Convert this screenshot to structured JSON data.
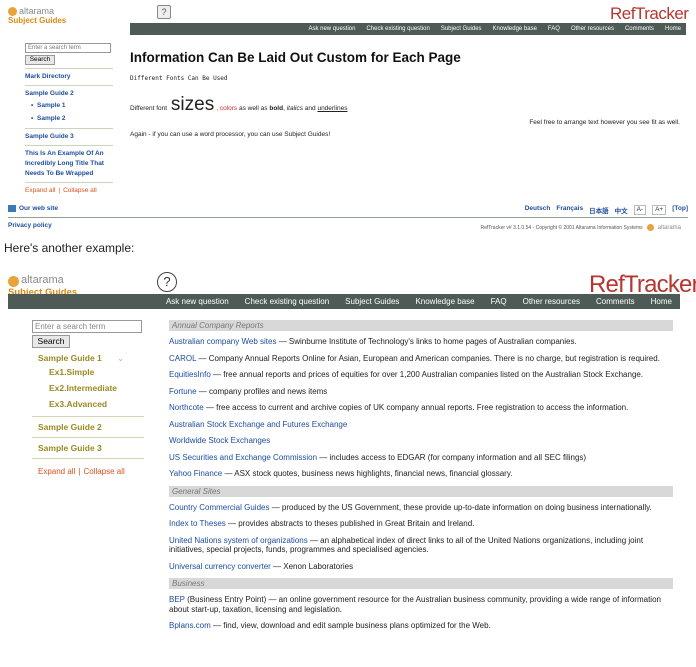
{
  "shot1": {
    "logo_brand": "altarama",
    "logo_subtitle": "Subject Guides",
    "help_icon": "help-icon",
    "reftracker": "RefTracker",
    "nav": [
      "Ask new question",
      "Check existing question",
      "Subject Guides",
      "Knowledge base",
      "FAQ",
      "Other resources",
      "Comments",
      "Home"
    ],
    "search_placeholder": "Enter a search term",
    "search_button": "Search",
    "sidebar": {
      "mark_directory": "Mark Directory",
      "guide1": "Sample Guide 2",
      "sub1": "Sample 1",
      "sub2": "Sample 2",
      "guide3": "Sample Guide 3",
      "long_title": "This Is An Example Of An Incredibly Long Title That Needs To Be Wrapped",
      "expand_all": "Expand all",
      "sep": "|",
      "collapse_all": "Collapse all"
    },
    "main": {
      "heading": "Information Can Be Laid Out Custom for Each Page",
      "mono_line": "Different Fonts Can Be Used",
      "pre": "Different font",
      "big": "sizes",
      "comma": ",",
      "colors": "colors",
      "mid1": "as well as",
      "bold": "bold",
      "mid2": ",",
      "italics": "italics",
      "mid3": "and",
      "underline": "underlines",
      "right_note": "Feel free to arrange text however you see fit as well.",
      "again": "Again - if you can use a word processor, you can use Subject Guides!"
    },
    "footer": {
      "our_web_site": "Our web site",
      "langs": [
        "Deutsch",
        "Français",
        "日本語",
        "中文"
      ],
      "font_minus": "A-",
      "font_plus": "A+",
      "top": "[Top]",
      "privacy": "Privacy policy",
      "copyright": "RefTracker v# 3.1.0.54 - Copyright © 2001 Altarama Information Systems",
      "brand": "altarama"
    }
  },
  "caption": "Here's another example:",
  "shot2": {
    "logo_brand": "altarama",
    "logo_subtitle": "Subject Guides",
    "help_glyph": "?",
    "reftracker": "RefTracker",
    "nav": [
      "Ask new question",
      "Check existing question",
      "Subject Guides",
      "Knowledge base",
      "FAQ",
      "Other resources",
      "Comments",
      "Home"
    ],
    "search_placeholder": "Enter a search term",
    "search_button": "Search",
    "sidebar": {
      "guide1": "Sample Guide 1",
      "sub1": "Ex1.Simple",
      "sub2": "Ex2.Intermediate",
      "sub3": "Ex3.Advanced",
      "guide2": "Sample Guide 2",
      "guide3": "Sample Guide 3",
      "expand_all": "Expand all",
      "sep": "|",
      "collapse_all": "Collapse all"
    },
    "sections": [
      {
        "title": "Annual Company Reports",
        "items": [
          {
            "link": "Australian company Web sites",
            "text": " — Swinburne Institute of Technology's links to home pages of Australian companies."
          },
          {
            "link": "CAROL",
            "text": " — Company Annual Reports Online for Asian, European and American companies. There is no charge, but registration is required."
          },
          {
            "link": "EquitiesInfo",
            "text": " — free annual reports and prices of equities for over 1,200 Australian companies listed on the Australian Stock Exchange."
          },
          {
            "link": "Fortune",
            "text": " — company profiles and news items"
          },
          {
            "link": "Northcote",
            "text": " — free access to current and archive copies of UK company annual reports. Free registration to access the information."
          },
          {
            "link": "Australian Stock Exchange and Futures Exchange",
            "text": ""
          },
          {
            "link": "Worldwide Stock Exchanges",
            "text": ""
          },
          {
            "link": "US Securities and Exchange Commission",
            "text": " — includes access to EDGAR (for company information and all SEC filings)"
          },
          {
            "link": "Yahoo Finance",
            "text": " — ASX stock quotes, business news highlights, financial news, financial glossary."
          }
        ]
      },
      {
        "title": "General Sites",
        "items": [
          {
            "link": "Country Commercial Guides",
            "text": " — produced by the US Government, these provide up-to-date information on doing business internationally."
          },
          {
            "link": "Index to Theses",
            "text": " — provides abstracts to theses published in Great Britain and Ireland."
          },
          {
            "link": "United Nations system of organizations",
            "text": " — an alphabetical index of direct links to all of the United Nations organizations, including joint initiatives, special projects, funds, programmes and specialised agencies."
          },
          {
            "link": "Universal currency converter",
            "text": " — Xenon Laboratories"
          }
        ]
      },
      {
        "title": "Business",
        "items": [
          {
            "link": "BEP",
            "text": " (Business Entry Point) — an online government resource for the Australian business community, providing a wide range of information about start-up, taxation, licensing and legislation."
          },
          {
            "link": "Bplans.com",
            "text": " — find, view, download and edit sample business plans optimized for the Web."
          }
        ]
      }
    ]
  }
}
